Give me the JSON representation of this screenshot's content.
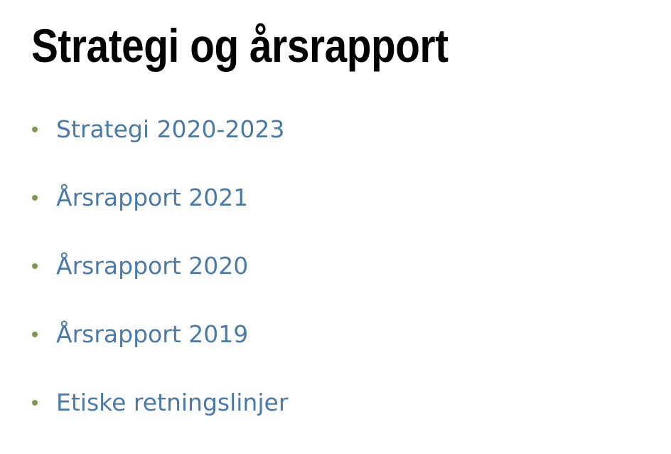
{
  "page": {
    "title": "Strategi og årsrapport"
  },
  "colors": {
    "link": "#4a7aa8",
    "bullet": "#7a9a4f",
    "title": "#000000"
  },
  "links": [
    {
      "label": "Strategi 2020-2023"
    },
    {
      "label": "Årsrapport 2021"
    },
    {
      "label": "Årsrapport 2020"
    },
    {
      "label": "Årsrapport 2019"
    },
    {
      "label": "Etiske retningslinjer"
    }
  ]
}
